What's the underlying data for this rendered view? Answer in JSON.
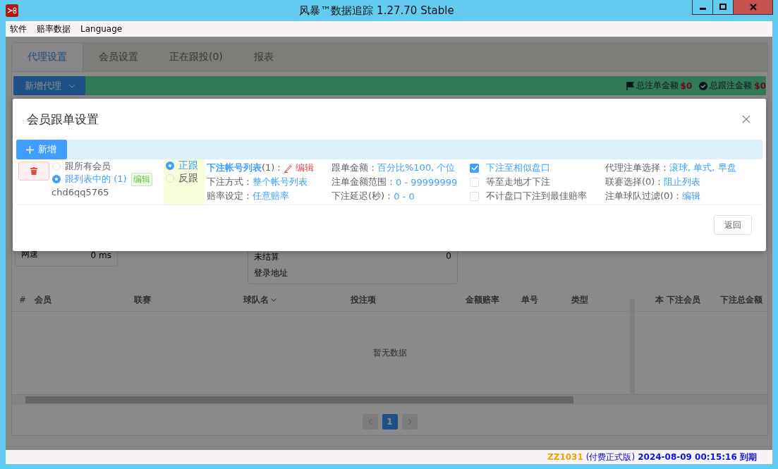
{
  "window": {
    "title": "风暴™数据追踪 1.27.70 Stable"
  },
  "menu": [
    "软件",
    "赔率数据",
    "Language"
  ],
  "tabs": [
    {
      "label": "代理设置",
      "selected": true
    },
    {
      "label": "会员设置",
      "selected": false
    },
    {
      "label": "正在跟投(0)",
      "selected": false
    },
    {
      "label": "报表",
      "selected": false
    }
  ],
  "add_agent_button": "新增代理",
  "stats": [
    {
      "label": "总注单金额",
      "value": "$0",
      "kind": "flag"
    },
    {
      "label": "总跟注金额",
      "value": "$0",
      "kind": "check"
    }
  ],
  "net_speed": {
    "label": "网速",
    "value": "0 ms"
  },
  "summary": [
    {
      "label": "未结算",
      "value": "0"
    },
    {
      "label": "登录地址"
    }
  ],
  "table": {
    "columns": [
      "#",
      "会员",
      "联赛",
      "球队名",
      "投注项",
      "金额赔率",
      "单号",
      "类型",
      "本",
      "下注会员",
      "下注总金额"
    ],
    "empty_text": "暂无数据"
  },
  "pagination": [
    {
      "label": "1",
      "selected": true
    }
  ],
  "modal": {
    "title": "会员跟单设置",
    "add_button": "新增",
    "scope": [
      {
        "label": "跟所有会员",
        "selected": false
      },
      {
        "label": "跟列表中的 (1)",
        "selected": true
      }
    ],
    "scope_edit": "编辑",
    "member": "chd6qq5765",
    "direction": [
      {
        "label": "正跟",
        "selected": true
      },
      {
        "label": "反跟",
        "selected": false
      }
    ],
    "account_list": {
      "label": "下注帐号列表",
      "count": "(1)：",
      "action": "编辑"
    },
    "fields_1": [
      {
        "label": "下注方式：",
        "value": "整个帐号列表"
      },
      {
        "label": "赔率设定：",
        "value": "任意赔率"
      }
    ],
    "fields_2": [
      {
        "label": "跟单金额：",
        "value": "百分比%100, 个位"
      },
      {
        "label": "注单金额范围：",
        "value": "0 - 99999999"
      },
      {
        "label": "下注延迟(秒)：",
        "value": "0 - 0"
      }
    ],
    "checks": [
      {
        "label": "下注至相似盘口",
        "checked": true
      },
      {
        "label": "等至走地才下注",
        "checked": false
      },
      {
        "label": "不计盘口下注到最佳赔率",
        "checked": false
      }
    ],
    "fields_3": [
      {
        "label": "代理注单选择：",
        "value": "滚球, 单式, 早盘"
      },
      {
        "label": "联赛选择(0)：",
        "value": "阻止列表"
      },
      {
        "label": "注单球队过滤(0)：",
        "value": "编辑"
      }
    ],
    "back_button": "返回"
  },
  "status_bar": {
    "account": "ZZ1031",
    "edition": "(付费正式版)",
    "expiry": "2024-08-09 00:15:16 到期"
  }
}
